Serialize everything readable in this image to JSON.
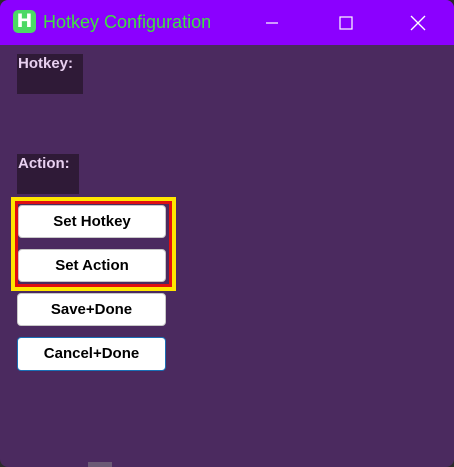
{
  "window": {
    "title": "Hotkey Configuration",
    "app_icon_letter": "H",
    "controls": {
      "minimize_icon": "minimize-icon",
      "maximize_icon": "maximize-icon",
      "close_icon": "close-icon"
    }
  },
  "labels": {
    "hotkey": "Hotkey:",
    "action": "Action:"
  },
  "buttons": {
    "set_hotkey": "Set Hotkey",
    "set_action": "Set Action",
    "save_done": "Save+Done",
    "cancel_done": "Cancel+Done"
  },
  "colors": {
    "titlebar": "#8b00ff",
    "title_text": "#40e040",
    "window_bg": "#4b2a5f",
    "label_bg": "#2f1a37",
    "highlight_outer": "#ffe600",
    "highlight_inner": "#e01010"
  }
}
